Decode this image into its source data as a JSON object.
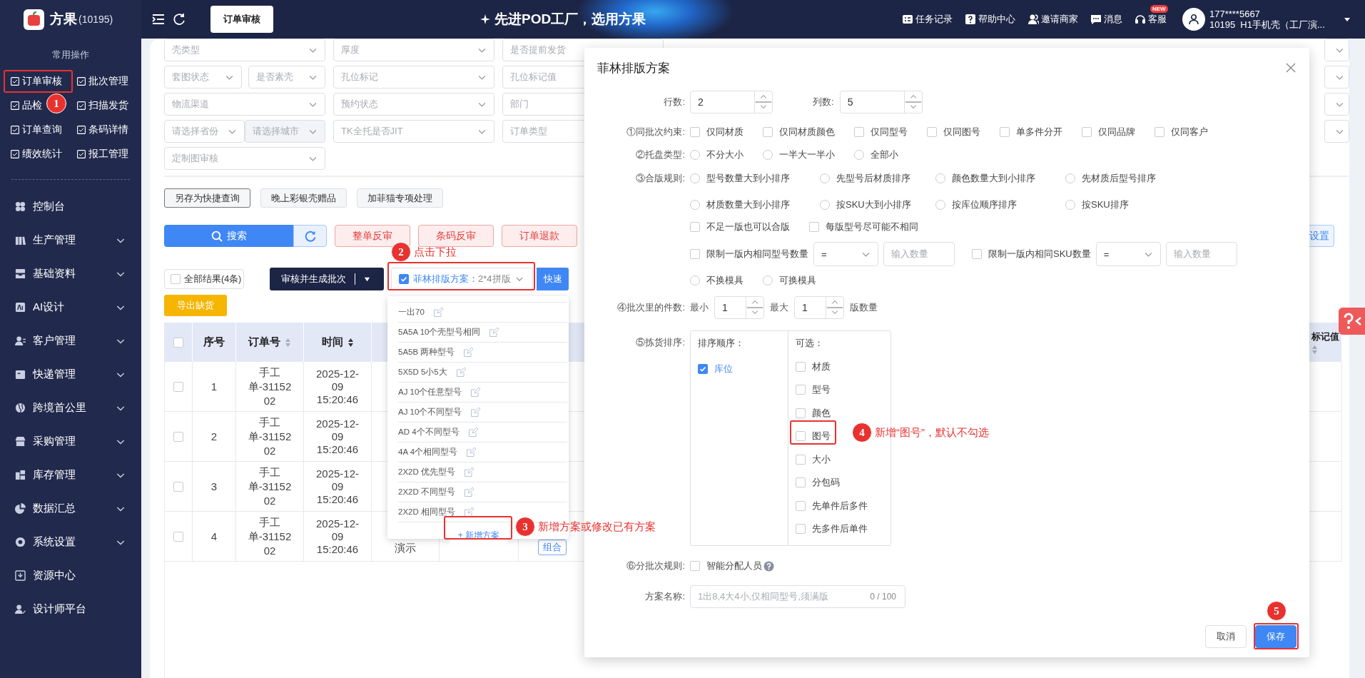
{
  "sidebar": {
    "brand": "方果",
    "account": "(10195)",
    "quick_title": "常用操作",
    "quick_items": [
      {
        "label": "订单审核"
      },
      {
        "label": "批次管理"
      },
      {
        "label": "品检"
      },
      {
        "label": "扫描发货"
      },
      {
        "label": "订单查询"
      },
      {
        "label": "条码详情"
      },
      {
        "label": "绩效统计"
      },
      {
        "label": "报工管理"
      }
    ],
    "menu": [
      {
        "label": "控制台",
        "kind": "link"
      },
      {
        "label": "生产管理",
        "kind": "group"
      },
      {
        "label": "基础资料",
        "kind": "group"
      },
      {
        "label": "AI设计",
        "kind": "group"
      },
      {
        "label": "客户管理",
        "kind": "group"
      },
      {
        "label": "快递管理",
        "kind": "group"
      },
      {
        "label": "跨境首公里",
        "kind": "group"
      },
      {
        "label": "采购管理",
        "kind": "group"
      },
      {
        "label": "库存管理",
        "kind": "group"
      },
      {
        "label": "数据汇总",
        "kind": "group"
      },
      {
        "label": "系统设置",
        "kind": "group"
      },
      {
        "label": "资源中心",
        "kind": "link"
      },
      {
        "label": "设计师平台",
        "kind": "link"
      }
    ]
  },
  "header": {
    "tab": "订单审核",
    "slogan": "先进POD工厂，选用方果",
    "links": [
      {
        "label": "任务记录"
      },
      {
        "label": "帮助中心"
      },
      {
        "label": "邀请商家"
      },
      {
        "label": "消息"
      },
      {
        "label": "客服",
        "badge": "NEW"
      }
    ],
    "user": {
      "phone": "177****5667",
      "org": "10195  H1手机壳（工厂演..."
    }
  },
  "filters": [
    [
      [
        {
          "placeholder": "壳类型",
          "kind": "select",
          "disabled": false
        }
      ],
      [
        {
          "placeholder": "厚度",
          "kind": "select",
          "disabled": false
        }
      ],
      [
        {
          "placeholder": "是否提前发货",
          "kind": "select",
          "disabled": false
        }
      ]
    ],
    [
      [
        {
          "placeholder": "套图状态",
          "kind": "select",
          "disabled": false
        },
        {
          "placeholder": "是否素壳",
          "kind": "select",
          "disabled": false
        }
      ],
      [
        {
          "placeholder": "孔位标记",
          "kind": "select",
          "disabled": false
        }
      ],
      [
        {
          "placeholder": "孔位标记值",
          "kind": "input",
          "disabled": false
        }
      ]
    ],
    [
      [
        {
          "placeholder": "物流渠道",
          "kind": "select",
          "disabled": false
        }
      ],
      [
        {
          "placeholder": "预约状态",
          "kind": "select",
          "disabled": false
        }
      ],
      [
        {
          "placeholder": "部门",
          "kind": "input",
          "disabled": false
        }
      ]
    ],
    [
      [
        {
          "placeholder": "请选择省份",
          "kind": "select",
          "disabled": false
        },
        {
          "placeholder": "请选择城市",
          "kind": "select",
          "disabled": true
        }
      ],
      [
        {
          "placeholder": "TK全托是否JIT",
          "kind": "select",
          "disabled": false
        }
      ],
      [
        {
          "placeholder": "订单类型",
          "kind": "input",
          "disabled": false
        }
      ]
    ],
    [
      [
        {
          "placeholder": "定制图审核",
          "kind": "select",
          "disabled": false
        }
      ]
    ]
  ],
  "saved_queries": [
    {
      "label": "另存为快捷查询",
      "kind": "outline"
    },
    {
      "label": "晚上彩银壳赠品",
      "kind": "plain"
    },
    {
      "label": "加菲猫专项处理",
      "kind": "plain"
    }
  ],
  "search_button": "搜索",
  "settings_button": "设置",
  "danger_buttons": [
    "整单反审",
    "条码反审",
    "订单退款"
  ],
  "all_results": {
    "label": "全部结果(4条)",
    "checked": false
  },
  "review_button": "审核并生成批次",
  "scheme_select": {
    "checked": true,
    "label": "菲林排版方案：",
    "value": "2*4拼版"
  },
  "quick_button": "快速",
  "export_button": "导出缺货",
  "table": {
    "select_all_checked": false,
    "columns": [
      {
        "label": "序号",
        "sortable": false
      },
      {
        "label": "订单号",
        "sortable": true,
        "sorted": false
      },
      {
        "label": "时间",
        "sortable": true,
        "sorted": true
      },
      {
        "label": "标记值",
        "sortable": true,
        "sorted": false
      }
    ],
    "rows": [
      {
        "checked": false,
        "index": "1",
        "order_no": "手工单-3115202",
        "time": "2025-12-09 15:20:46"
      },
      {
        "checked": false,
        "index": "2",
        "order_no": "手工单-3115202",
        "time": "2025-12-09 15:20:46"
      },
      {
        "checked": false,
        "index": "3",
        "order_no": "手工单-3115202",
        "time": "2025-12-09 15:20:46"
      },
      {
        "checked": false,
        "index": "4",
        "order_no": "手工单-3115202",
        "time": "2025-12-09 15:20:46",
        "column_5": "演示",
        "column_7": "组合"
      }
    ]
  },
  "scheme_menu": {
    "items": [
      {
        "label": "一出70"
      },
      {
        "label": "5A5A 10个壳型号相同"
      },
      {
        "label": "5A5B 两种型号"
      },
      {
        "label": "5X5D 5小5大"
      },
      {
        "label": "AJ 10个任意型号"
      },
      {
        "label": "AJ 10个不同型号"
      },
      {
        "label": "AD 4个不同型号"
      },
      {
        "label": "4A 4个相同型号"
      },
      {
        "label": "2X2D 优先型号"
      },
      {
        "label": "2X2D 不同型号"
      },
      {
        "label": "2X2D 相同型号"
      }
    ],
    "add_button": "+ 新增方案"
  },
  "dialog": {
    "title": "菲林排版方案",
    "rows_label": "行数:",
    "rows_value": "2",
    "cols_label": "列数:",
    "cols_value": "5",
    "constraint": {
      "label": "①同批次约束:",
      "options": [
        {
          "label": "仅同材质",
          "checked": false
        },
        {
          "label": "仅同材质颜色",
          "checked": false
        },
        {
          "label": "仅同型号",
          "checked": false
        },
        {
          "label": "仅同图号",
          "checked": false
        },
        {
          "label": "单多件分开",
          "checked": false
        },
        {
          "label": "仅同品牌",
          "checked": false
        },
        {
          "label": "仅同客户",
          "checked": false
        }
      ]
    },
    "tray": {
      "label": "②托盘类型:",
      "options": [
        {
          "label": "不分大小",
          "selected": false
        },
        {
          "label": "一半大一半小",
          "selected": false
        },
        {
          "label": "全部小",
          "selected": false
        }
      ]
    },
    "merge": {
      "label": "③合版规则:",
      "sort_options": [
        {
          "label": "型号数量大到小排序",
          "selected": false
        },
        {
          "label": "先型号后材质排序",
          "selected": false
        },
        {
          "label": "颜色数量大到小排序",
          "selected": false
        },
        {
          "label": "先材质后型号排序",
          "selected": false
        },
        {
          "label": "材质数量大到小排序",
          "selected": false
        },
        {
          "label": "按SKU大到小排序",
          "selected": false
        },
        {
          "label": "按库位顺序排序",
          "selected": false
        },
        {
          "label": "按SKU排序",
          "selected": false
        }
      ],
      "flags": [
        {
          "label": "不足一版也可以合版",
          "checked": false
        },
        {
          "label": "每版型号尽可能不相同",
          "checked": false
        }
      ],
      "limits": [
        {
          "label": "限制一版内相同型号数量",
          "checked": false,
          "operator": "=",
          "placeholder": "输入数量"
        },
        {
          "label": "限制一版内相同SKU数量",
          "checked": false,
          "operator": "=",
          "placeholder": "输入数量"
        }
      ],
      "mold_options": [
        {
          "label": "不换模具",
          "selected": false
        },
        {
          "label": "可换模具",
          "selected": false
        }
      ]
    },
    "batch_count": {
      "label": "④批次里的件数:",
      "min_label": "最小",
      "min_value": "1",
      "max_label": "最大",
      "max_value": "1",
      "unit": "版数量"
    },
    "picking": {
      "label": "⑤拣货排序:",
      "order_title": "排序顺序：",
      "order_items": [
        {
          "label": "库位",
          "checked": true
        }
      ],
      "optional_title": "可选：",
      "optional_items": [
        {
          "label": "材质",
          "checked": false
        },
        {
          "label": "型号",
          "checked": false
        },
        {
          "label": "颜色",
          "checked": false
        },
        {
          "label": "图号",
          "checked": false
        },
        {
          "label": "大小",
          "checked": false
        },
        {
          "label": "分包码",
          "checked": false
        },
        {
          "label": "先单件后多件",
          "checked": false
        },
        {
          "label": "先多件后单件",
          "checked": false
        }
      ]
    },
    "split": {
      "label": "⑥分批次规则:",
      "options": [
        {
          "label": "智能分配人员",
          "checked": false
        }
      ]
    },
    "name": {
      "label": "方案名称:",
      "placeholder": "1出8,4大4小,仅相同型号,须满版",
      "counter": "0 / 100"
    },
    "buttons": [
      {
        "label": "取消",
        "kind": "default"
      },
      {
        "label": "保存",
        "kind": "primary"
      }
    ]
  },
  "annotations": [
    {
      "number": "1"
    },
    {
      "number": "2",
      "text": "点击下拉"
    },
    {
      "number": "3",
      "text": "新增方案或修改已有方案"
    },
    {
      "number": "4",
      "text": "新增“图号”，默认不勾选"
    },
    {
      "number": "5"
    }
  ]
}
